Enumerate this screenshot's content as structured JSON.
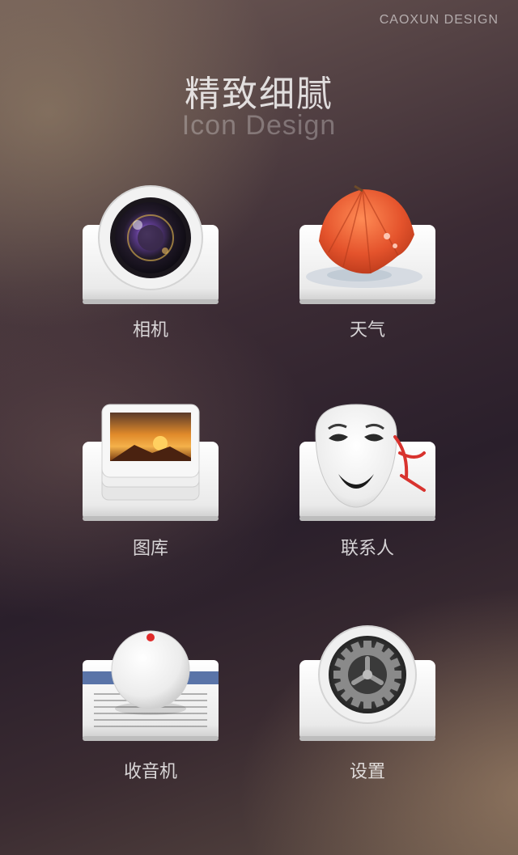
{
  "brand": "CAOXUN DESIGN",
  "header": {
    "title": "精致细腻",
    "subtitle": "Icon Design"
  },
  "apps": [
    {
      "label": "相机",
      "icon": "camera-icon"
    },
    {
      "label": "天气",
      "icon": "weather-umbrella-icon"
    },
    {
      "label": "图库",
      "icon": "gallery-photo-icon"
    },
    {
      "label": "联系人",
      "icon": "contacts-mask-icon"
    },
    {
      "label": "收音机",
      "icon": "radio-dial-icon"
    },
    {
      "label": "设置",
      "icon": "settings-gear-icon"
    }
  ],
  "colors": {
    "umbrella": "#e4532c",
    "radio_stripe": "#5a74a8",
    "radio_dot": "#e02a2a",
    "ribbon": "#d8332e"
  }
}
